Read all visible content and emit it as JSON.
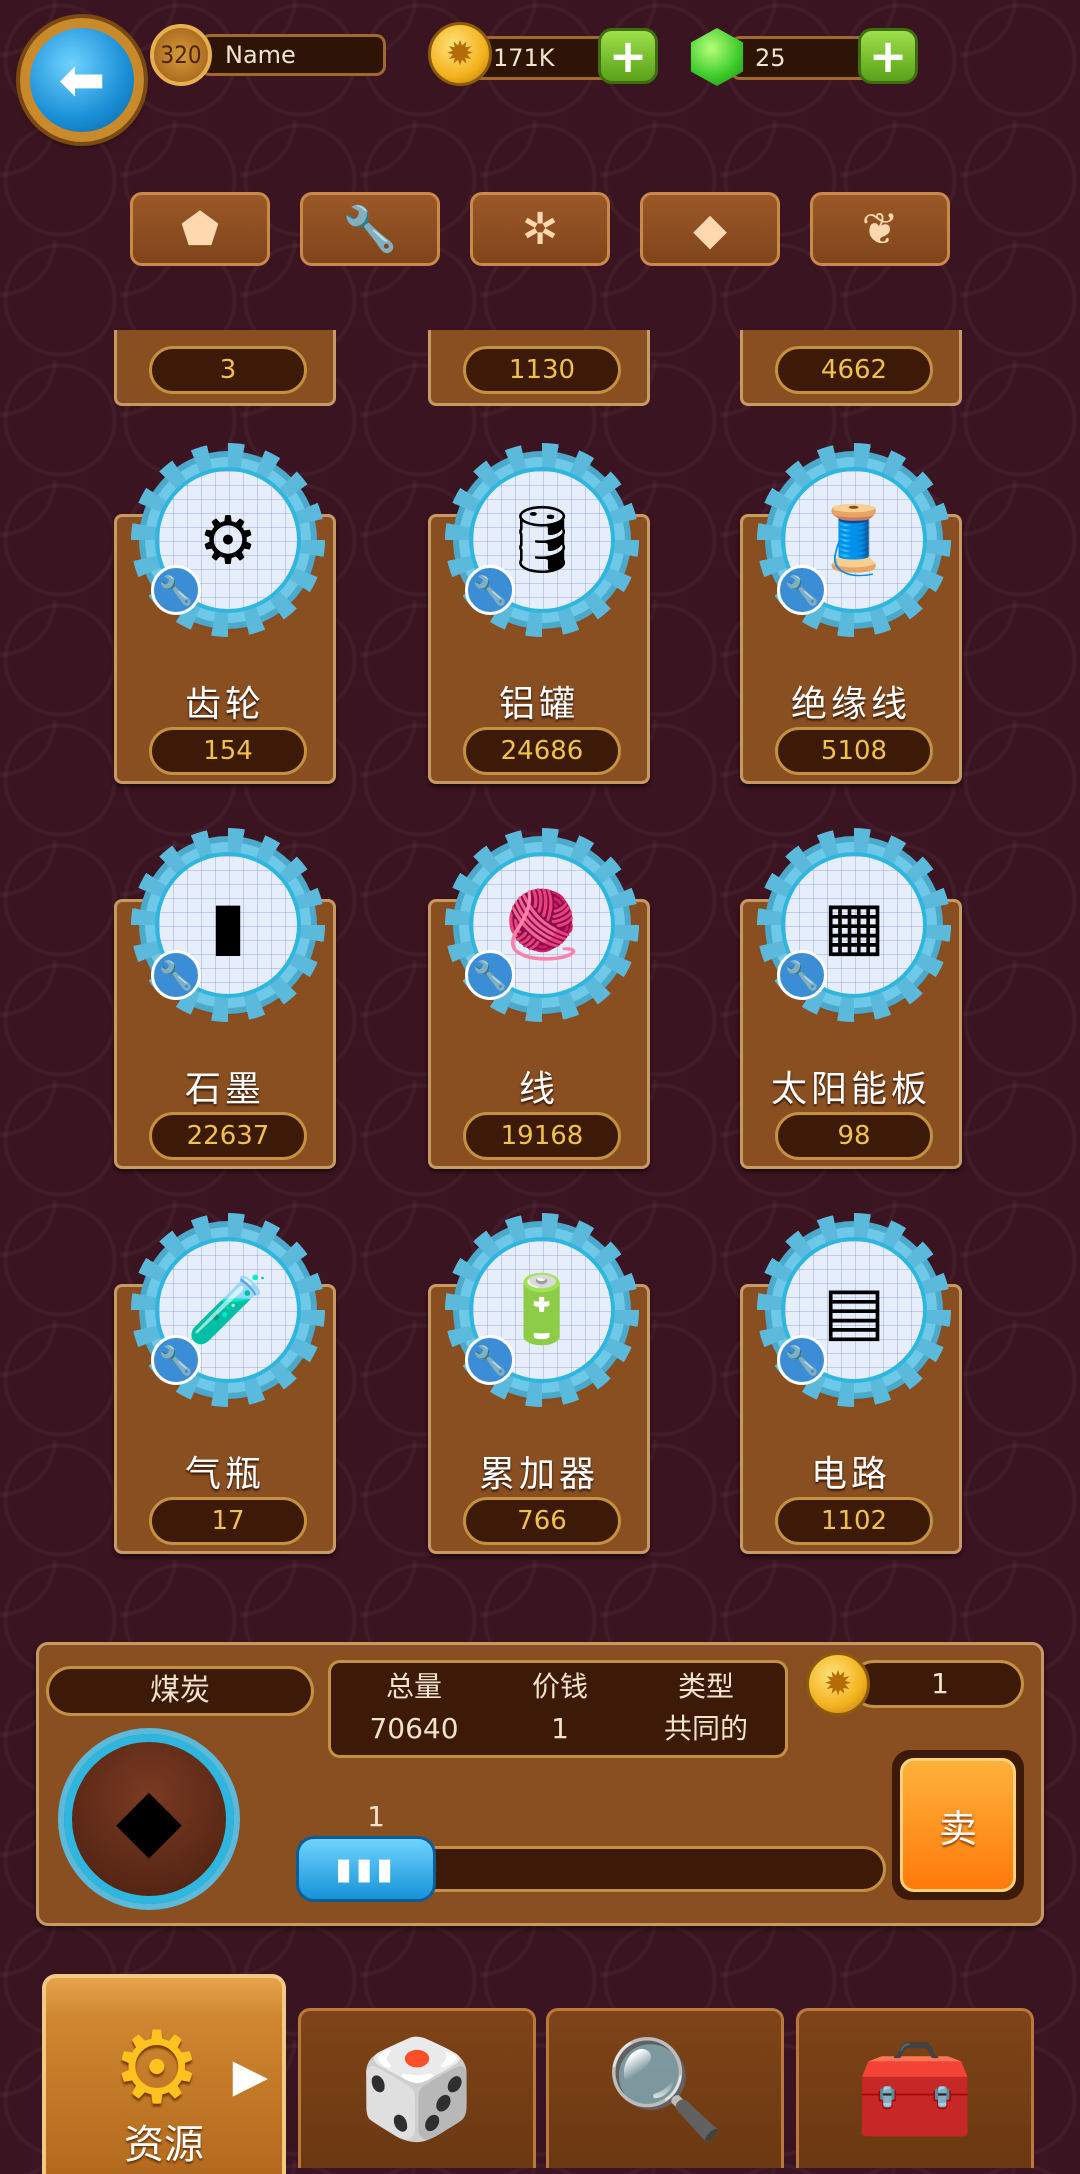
{
  "header": {
    "level": "320",
    "player_name": "Name",
    "coins": "171K",
    "gems": "25"
  },
  "category_tabs": [
    {
      "icon": "rock-icon",
      "glyph": "⬟"
    },
    {
      "icon": "wrench-icon",
      "glyph": "🔧"
    },
    {
      "icon": "molecule-icon",
      "glyph": "✲"
    },
    {
      "icon": "diamond-icon",
      "glyph": "◆"
    },
    {
      "icon": "sprout-icon",
      "glyph": "❦"
    }
  ],
  "partial_row": [
    "3",
    "1130",
    "4662"
  ],
  "items": [
    {
      "name": "齿轮",
      "count": "154",
      "icon": "gear-item-icon",
      "glyph": "⚙"
    },
    {
      "name": "铝罐",
      "count": "24686",
      "icon": "aluminum-tank-icon",
      "glyph": "🛢"
    },
    {
      "name": "绝缘线",
      "count": "5108",
      "icon": "wire-spool-icon",
      "glyph": "🧵"
    },
    {
      "name": "石墨",
      "count": "22637",
      "icon": "graphite-rod-icon",
      "glyph": "▮"
    },
    {
      "name": "线",
      "count": "19168",
      "icon": "thread-spool-icon",
      "glyph": "🧶"
    },
    {
      "name": "太阳能板",
      "count": "98",
      "icon": "solar-panel-icon",
      "glyph": "▦"
    },
    {
      "name": "气瓶",
      "count": "17",
      "icon": "gas-bottle-icon",
      "glyph": "🧪"
    },
    {
      "name": "累加器",
      "count": "766",
      "icon": "accumulator-icon",
      "glyph": "🔋"
    },
    {
      "name": "电路",
      "count": "1102",
      "icon": "circuit-board-icon",
      "glyph": "▤"
    }
  ],
  "detail": {
    "selected_name": "煤炭",
    "labels": {
      "total": "总量",
      "price": "价钱",
      "type": "类型"
    },
    "values": {
      "total": "70640",
      "price": "1",
      "type": "共同的"
    },
    "sell_price": "1",
    "quantity": "1",
    "slider_fraction": 0,
    "sell_label": "卖"
  },
  "bottom_nav": {
    "active_label": "资源",
    "tabs": [
      "resources-tab",
      "dice-tab",
      "search-tab",
      "chest-tab"
    ]
  },
  "colors": {
    "background": "#3b1421",
    "card": "#8a4f21",
    "count_text": "#f0c24a",
    "accent_blue": "#2fb6df",
    "sell_orange": "#ff7a0b"
  }
}
